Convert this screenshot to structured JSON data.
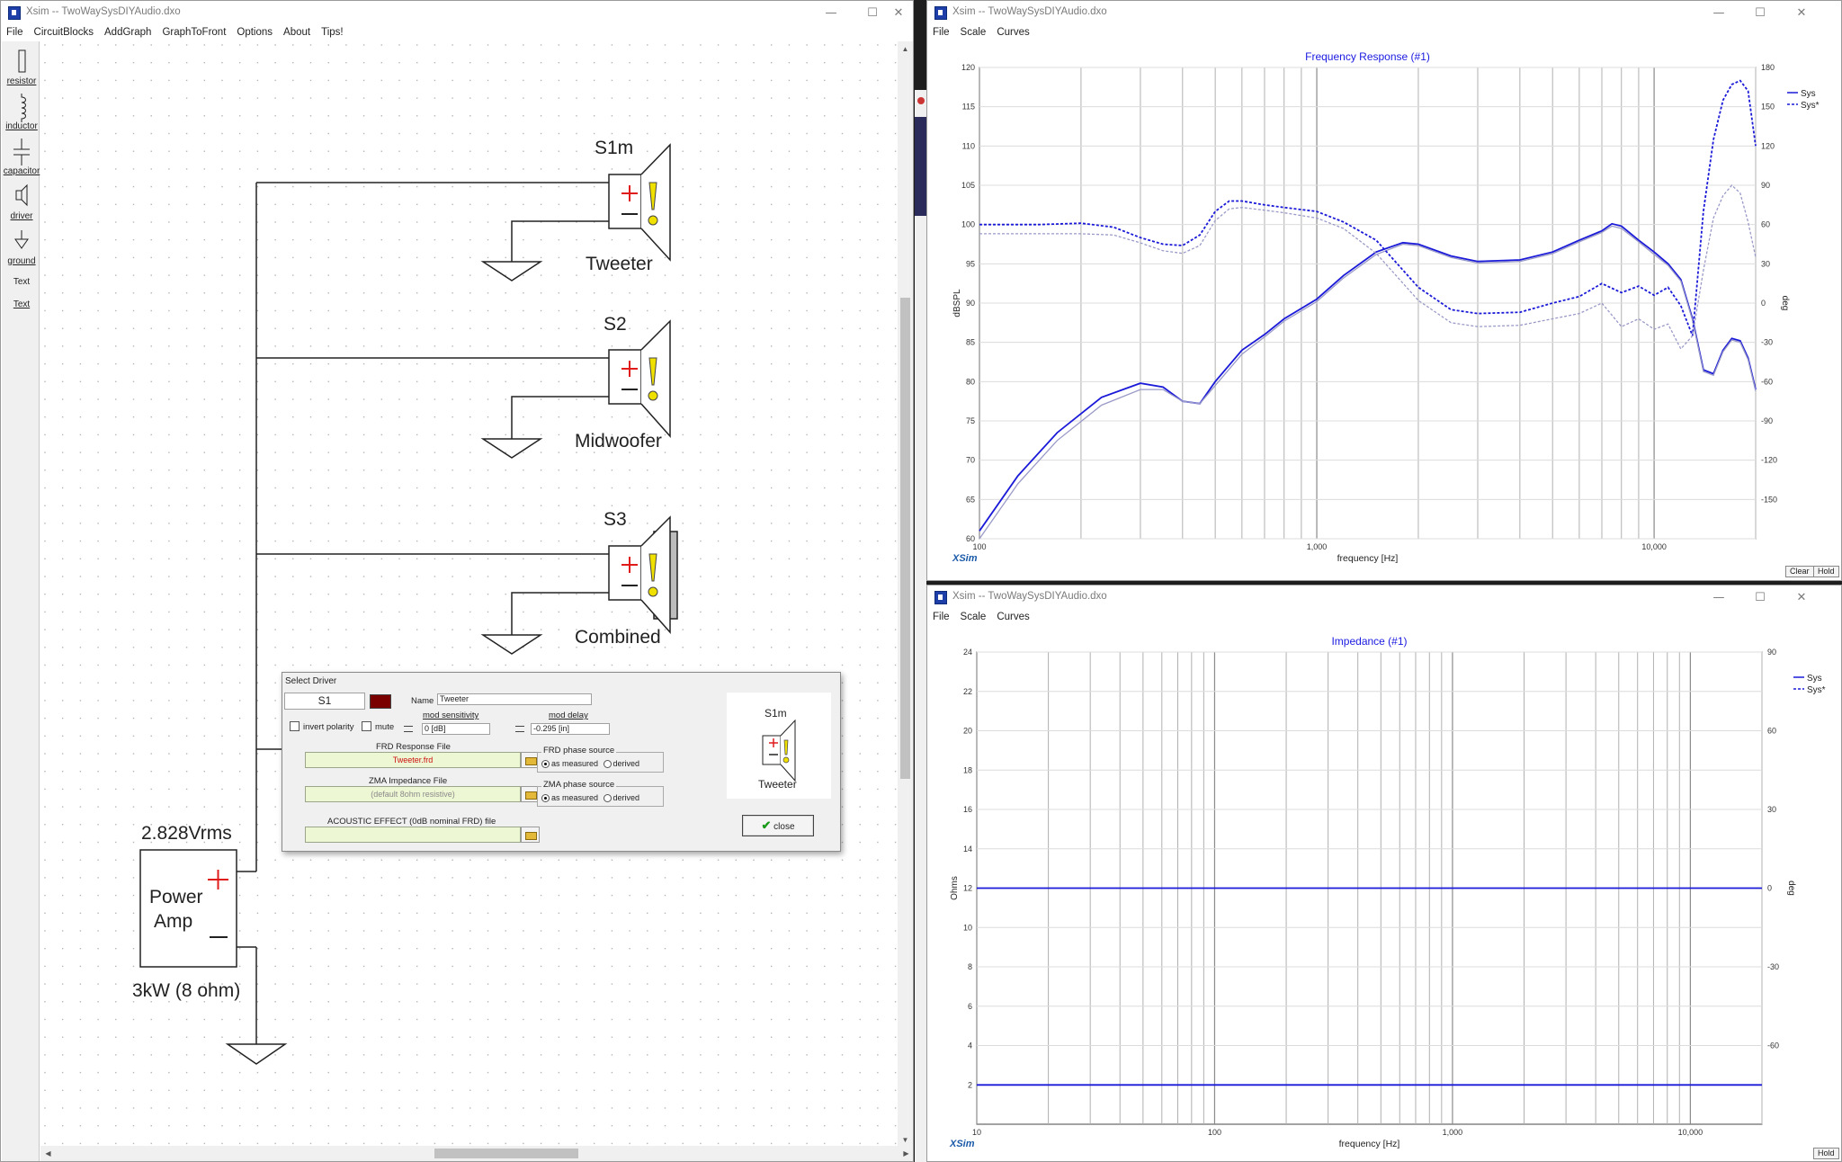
{
  "schematic_window": {
    "title": "Xsim -- TwoWaySysDIYAudio.dxo",
    "menu": [
      "File",
      "CircuitBlocks",
      "AddGraph",
      "GraphToFront",
      "Options",
      "About",
      "Tips!"
    ],
    "toolbox": [
      "resistor",
      "inductor",
      "capacitor",
      "driver",
      "ground",
      "Text",
      "Text"
    ],
    "components": {
      "s1_name": "S1m",
      "s1_label": "Tweeter",
      "s2_name": "S2",
      "s2_label": "Midwoofer",
      "s3_name": "S3",
      "s3_label": "Combined",
      "amp_voltage": "2.828Vrms",
      "amp_name_line1": "Power",
      "amp_name_line2": "Amp",
      "amp_power": "3kW (8 ohm)"
    }
  },
  "dialog": {
    "title": "Select Driver",
    "driver_id": "S1",
    "driver_color": "#7a0000",
    "name_label": "Name",
    "name_value": "Tweeter",
    "invert_polarity": "invert polarity",
    "mute": "mute",
    "mod_sensitivity_label": "mod sensitivity",
    "mod_sensitivity_value": "0 [dB]",
    "mod_delay_label": "mod delay",
    "mod_delay_value": "-0.295 [in]",
    "frd_label": "FRD Response File",
    "frd_value": "Tweeter.frd",
    "frd_phase_label": "FRD phase source",
    "zma_label": "ZMA Impedance File",
    "zma_value": "(default 8ohm resistive)",
    "zma_phase_label": "ZMA phase source",
    "as_measured": "as measured",
    "derived": "derived",
    "acoustic_label": "ACOUSTIC EFFECT (0dB nominal FRD) file",
    "preview_name": "S1m",
    "preview_label": "Tweeter",
    "close_label": "close"
  },
  "freq_window": {
    "title": "Xsim -- TwoWaySysDIYAudio.dxo",
    "menu": [
      "File",
      "Scale",
      "Curves"
    ],
    "brand": "XSim",
    "buttons": [
      "Clear",
      "Hold"
    ]
  },
  "imp_window": {
    "title": "Xsim -- TwoWaySysDIYAudio.dxo",
    "menu": [
      "File",
      "Scale",
      "Curves"
    ],
    "brand": "XSim",
    "buttons": [
      "Hold"
    ]
  },
  "chart_data": [
    {
      "type": "line",
      "title": "Frequency Response (#1)",
      "xlabel": "frequency [Hz]",
      "ylabel": "dBSPL",
      "y2label": "deg",
      "xscale": "log",
      "xlim": [
        100,
        20000
      ],
      "ylim": [
        60,
        120
      ],
      "y2lim": [
        -180,
        180
      ],
      "x_tick_labels": [
        "100",
        "1,000",
        "10,000"
      ],
      "y_ticks": [
        60,
        65,
        70,
        75,
        80,
        85,
        90,
        95,
        100,
        105,
        110,
        115,
        120
      ],
      "y2_ticks": [
        -150,
        -120,
        -90,
        -60,
        -30,
        0,
        30,
        60,
        90,
        120,
        150,
        180
      ],
      "grid": true,
      "legend": [
        "Sys",
        "Sys*"
      ],
      "legend_position": "top-right",
      "series": [
        {
          "name": "Sys",
          "axis": "left",
          "style": "solid",
          "color": "#1a1ad8",
          "x": [
            100,
            130,
            170,
            230,
            300,
            350,
            400,
            450,
            500,
            600,
            700,
            800,
            1000,
            1200,
            1500,
            1800,
            2000,
            2500,
            3000,
            4000,
            5000,
            6000,
            7000,
            7500,
            8000,
            9000,
            10000,
            11000,
            12000,
            13000,
            14000,
            15000,
            16000,
            17000,
            18000,
            19000,
            20000
          ],
          "y": [
            61,
            68,
            73.5,
            78,
            79.8,
            79.3,
            77.5,
            77.2,
            80,
            84,
            86,
            88,
            90.5,
            93.5,
            96.5,
            97.7,
            97.5,
            96,
            95.3,
            95.5,
            96.5,
            98,
            99.2,
            100.1,
            99.8,
            98,
            96.5,
            95,
            93,
            88,
            81.5,
            81,
            84,
            85.5,
            85.2,
            83,
            79
          ]
        },
        {
          "name": "Sys (gray)",
          "axis": "left",
          "style": "solid",
          "color": "#9a9ac8",
          "x": [
            100,
            130,
            170,
            230,
            300,
            350,
            400,
            450,
            500,
            600,
            700,
            800,
            1000,
            1200,
            1500,
            1800,
            2000,
            2500,
            3000,
            4000,
            5000,
            6000,
            7000,
            7500,
            8000,
            9000,
            10000,
            11000,
            12000,
            13000,
            14000,
            15000,
            16000,
            17000,
            18000,
            19000,
            20000
          ],
          "y": [
            60,
            67,
            72.5,
            77,
            79,
            79,
            77.5,
            77.2,
            79.5,
            83.5,
            85.7,
            87.7,
            90.2,
            93.2,
            96.2,
            97.5,
            97.3,
            95.8,
            95.1,
            95.3,
            96.3,
            97.8,
            99,
            99.8,
            99.5,
            97.8,
            96.2,
            94.8,
            92.8,
            87.8,
            81.3,
            80.8,
            83.8,
            85.3,
            85,
            82.8,
            78.8
          ]
        },
        {
          "name": "Sys*",
          "axis": "right",
          "style": "dashed",
          "color": "#1a1ad8",
          "x": [
            100,
            150,
            200,
            250,
            300,
            350,
            400,
            450,
            500,
            550,
            600,
            700,
            800,
            1000,
            1200,
            1500,
            2000,
            2500,
            3000,
            4000,
            5000,
            6000,
            7000,
            8000,
            9000,
            10000,
            11000,
            12000,
            13000,
            14000,
            15000,
            16000,
            17000,
            18000,
            19000,
            20000
          ],
          "y": [
            60,
            60,
            61,
            58,
            50,
            45,
            44,
            52,
            70,
            78,
            78,
            75,
            73,
            70,
            62,
            48,
            12,
            -5,
            -8,
            -7,
            0,
            5,
            15,
            8,
            13,
            6,
            12,
            -2,
            -25,
            70,
            125,
            155,
            167,
            170,
            162,
            120
          ]
        },
        {
          "name": "Sys* (gray)",
          "axis": "right",
          "style": "dashed",
          "color": "#9a9ac8",
          "x": [
            100,
            150,
            200,
            250,
            300,
            350,
            400,
            450,
            500,
            550,
            600,
            700,
            800,
            1000,
            1200,
            1500,
            2000,
            2500,
            3000,
            4000,
            5000,
            6000,
            7000,
            8000,
            9000,
            10000,
            11000,
            12000,
            13000,
            14000,
            15000,
            16000,
            17000,
            18000,
            19000,
            20000
          ],
          "y": [
            53,
            53,
            53,
            52,
            46,
            40,
            38,
            44,
            63,
            72,
            73,
            71,
            69,
            65,
            57,
            38,
            2,
            -15,
            -18,
            -17,
            -12,
            -8,
            0,
            -18,
            -12,
            -20,
            -16,
            -35,
            -25,
            25,
            65,
            82,
            90,
            84,
            62,
            35
          ]
        }
      ]
    },
    {
      "type": "line",
      "title": "Impedance (#1)",
      "xlabel": "frequency [Hz]",
      "ylabel": "Ohms",
      "y2label": "deg",
      "xscale": "log",
      "xlim": [
        10,
        20000
      ],
      "ylim": [
        0,
        24
      ],
      "y2lim": [
        -90,
        90
      ],
      "x_tick_labels": [
        "10",
        "100",
        "1,000",
        "10,000"
      ],
      "y_ticks": [
        2,
        4,
        6,
        8,
        10,
        12,
        14,
        16,
        18,
        20,
        22,
        24
      ],
      "y2_ticks": [
        -60,
        -30,
        0,
        30,
        60,
        90
      ],
      "grid": true,
      "legend": [
        "Sys",
        "Sys*"
      ],
      "legend_position": "top-right",
      "series": [
        {
          "name": "Sys",
          "axis": "left",
          "style": "solid",
          "color": "#1a1ad8",
          "x": [
            10,
            20000
          ],
          "y": [
            2,
            2
          ]
        },
        {
          "name": "Sys*",
          "axis": "right",
          "style": "solid",
          "color": "#1a1ad8",
          "x": [
            10,
            20000
          ],
          "y": [
            0,
            0
          ]
        }
      ]
    }
  ]
}
